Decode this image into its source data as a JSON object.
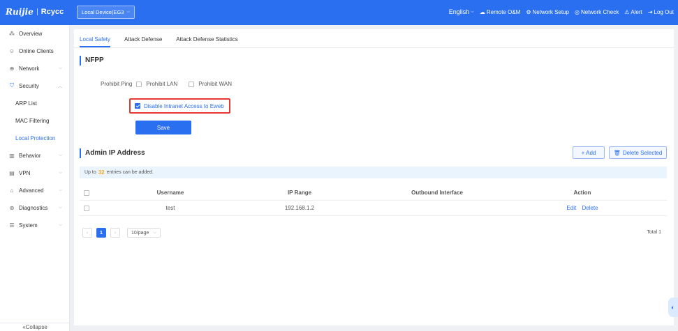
{
  "header": {
    "logo_brand": "Ruijie",
    "logo_sub": "Rcycc",
    "device_select": "Local Device(EG3",
    "language": "English",
    "nav": [
      {
        "icon": "cloud-icon",
        "glyph": "☁",
        "label": "Remote O&M"
      },
      {
        "icon": "gear-icon",
        "glyph": "⚙",
        "label": "Network Setup"
      },
      {
        "icon": "network-check-icon",
        "glyph": "◎",
        "label": "Network Check"
      },
      {
        "icon": "alert-icon",
        "glyph": "⚠",
        "label": "Alert"
      },
      {
        "icon": "logout-icon",
        "glyph": "⇥",
        "label": "Log Out"
      }
    ]
  },
  "sidebar": {
    "items": [
      {
        "label": "Overview",
        "icon": "overview-icon",
        "glyph": "⁂"
      },
      {
        "label": "Online Clients",
        "icon": "user-icon",
        "glyph": "☺"
      },
      {
        "label": "Network",
        "icon": "globe-icon",
        "glyph": "⊕"
      },
      {
        "label": "Security",
        "icon": "shield-icon",
        "glyph": "⛉"
      },
      {
        "label": "ARP List"
      },
      {
        "label": "MAC Filtering"
      },
      {
        "label": "Local Protection"
      },
      {
        "label": "Behavior",
        "icon": "behavior-icon",
        "glyph": "▥"
      },
      {
        "label": "VPN",
        "icon": "vpn-icon",
        "glyph": "▤"
      },
      {
        "label": "Advanced",
        "icon": "advanced-icon",
        "glyph": "⌂"
      },
      {
        "label": "Diagnostics",
        "icon": "diagnostics-icon",
        "glyph": "⊛"
      },
      {
        "label": "System",
        "icon": "system-icon",
        "glyph": "☰"
      }
    ],
    "collapse_label": "«Collapse"
  },
  "tabs": [
    "Local Safety",
    "Attack Defense",
    "Attack Defense Statistics"
  ],
  "nfpp": {
    "title": "NFPP",
    "prohibit_ping_label": "Prohibit Ping",
    "prohibit_lan_label": "Prohibit LAN",
    "prohibit_wan_label": "Prohibit WAN",
    "disable_eweb_label": "Disable Intranet Access to Eweb",
    "disable_eweb_checked": true,
    "save_label": "Save"
  },
  "admin_ip": {
    "title": "Admin IP Address",
    "add_label": "+ Add",
    "delete_label": "Delete Selected",
    "notice_prefix": "Up to",
    "notice_count": "32",
    "notice_suffix": "entries can be added.",
    "columns": {
      "username": "Username",
      "ip_range": "IP Range",
      "outbound": "Outbound Interface",
      "action": "Action"
    },
    "rows": [
      {
        "username": "test",
        "ip_range": "192.168.1.2",
        "outbound": "",
        "edit": "Edit",
        "delete": "Delete"
      }
    ],
    "pagination": {
      "prev": "‹",
      "current": "1",
      "next": "›",
      "page_size": "10/page",
      "total": "Total 1"
    }
  }
}
